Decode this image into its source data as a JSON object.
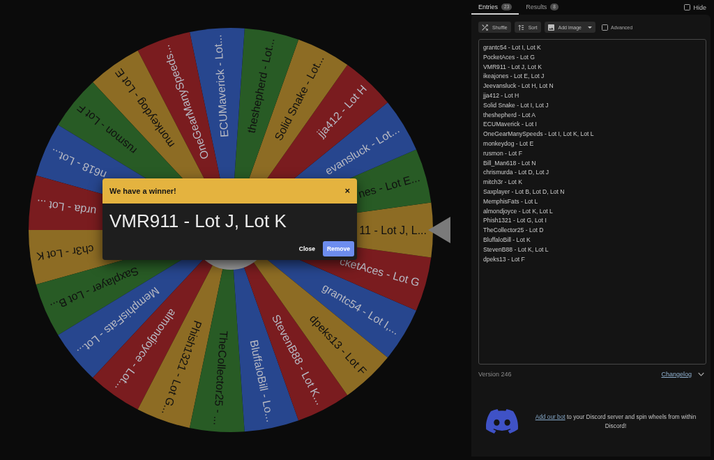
{
  "wheel": {
    "segments": [
      {
        "label": "grantc54 - Lot I,...",
        "color": "#27468e"
      },
      {
        "label": "cketAces - Lot G",
        "color": "#7a1c1f"
      },
      {
        "label": "11 - Lot J, L...",
        "color": "#8d6c24"
      },
      {
        "label": "nes - Lot E...",
        "color": "#285b25"
      },
      {
        "label": "evansluck - Lot...",
        "color": "#27468e"
      },
      {
        "label": "jja412 - Lot H",
        "color": "#7a1c1f"
      },
      {
        "label": "Solid Snake - Lot...",
        "color": "#8d6c24"
      },
      {
        "label": "theshepherd - Lot...",
        "color": "#285b25"
      },
      {
        "label": "ECUMaverick - Lot...",
        "color": "#27468e"
      },
      {
        "label": "OneGearManySpeeds...",
        "color": "#7a1c1f"
      },
      {
        "label": "monkeydog - Lot E",
        "color": "#8d6c24"
      },
      {
        "label": "rusmon - Lot F",
        "color": "#285b25"
      },
      {
        "label": "n618 - Lot...",
        "color": "#27468e"
      },
      {
        "label": "urda - Lot ...",
        "color": "#7a1c1f"
      },
      {
        "label": "ch3r - Lot K",
        "color": "#8d6c24"
      },
      {
        "label": "Saxplayer - Lot B...",
        "color": "#285b25"
      },
      {
        "label": "MemphisFats - Lot...",
        "color": "#27468e"
      },
      {
        "label": "almondjoyce - Lot...",
        "color": "#7a1c1f"
      },
      {
        "label": "Phish1321 - Lot G...",
        "color": "#8d6c24"
      },
      {
        "label": "TheCollector25 - ...",
        "color": "#285b25"
      },
      {
        "label": "BluffaloBill - Lo...",
        "color": "#27468e"
      },
      {
        "label": "StevenB88 - Lot K...",
        "color": "#7a1c1f"
      },
      {
        "label": "dpeks13 - Lot F",
        "color": "#8d6c24"
      }
    ]
  },
  "dialog": {
    "title": "We have a winner!",
    "close": "×",
    "winner": "VMR911 - Lot J, Lot K",
    "buttons": [
      {
        "label": "Close",
        "kind": "text"
      },
      {
        "label": "Remove",
        "kind": "primary"
      }
    ]
  },
  "tabs": [
    {
      "label": "Entries",
      "count": "23",
      "selected": true
    },
    {
      "label": "Results",
      "count": "8",
      "selected": false
    }
  ],
  "hide": {
    "label": "Hide",
    "checked": false
  },
  "toolbar": {
    "buttons": [
      {
        "label": "Shuffle",
        "kind": "shuffle",
        "dropdown": false
      },
      {
        "label": "Sort",
        "kind": "sort",
        "dropdown": false
      },
      {
        "label": "Add image",
        "kind": "image",
        "dropdown": true
      }
    ],
    "advanced": {
      "label": "Advanced",
      "checked": false
    }
  },
  "entries": [
    "grantc54 - Lot I, Lot K",
    "PocketAces - Lot G",
    "VMR911 - Lot J, Lot K",
    "ikeajones - Lot E, Lot J",
    "Jeevansluck - Lot H, Lot N",
    "jja412 - Lot H",
    "Solid Snake - Lot I, Lot J",
    "theshepherd - Lot A",
    "ECUMaverick - Lot I",
    "OneGearManySpeeds - Lot I, Lot K, Lot L",
    "monkeydog - Lot E",
    "rusmon - Lot F",
    "Bill_Man618 - Lot N",
    "chrismurda - Lot D, Lot J",
    "mitch3r - Lot K",
    "Saxplayer - Lot B, Lot D, Lot N",
    "MemphisFats - Lot L",
    "almondjoyce - Lot K, Lot L",
    "Phish1321 - Lot G, Lot I",
    "TheCollector25 - Lot D",
    "BluffaloBill - Lot K",
    "StevenB88 - Lot K, Lot L",
    "dpeks13 - Lot F"
  ],
  "footer": {
    "version": "Version 246",
    "changelog": "Changelog"
  },
  "discord": {
    "link": "Add our bot",
    "text": "to your Discord server and spin wheels from within Discord!"
  }
}
